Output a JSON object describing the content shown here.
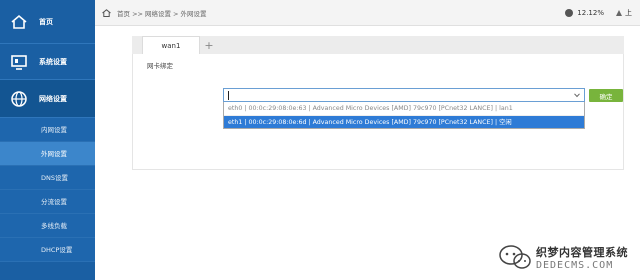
{
  "sidebar": {
    "top": {
      "label": "首页",
      "icon": "home-icon"
    },
    "items": [
      {
        "label": "系统设置",
        "icon": "monitor-icon"
      },
      {
        "label": "网络设置",
        "icon": "globe-icon"
      }
    ],
    "sub_items": [
      {
        "label": "内网设置",
        "selected": false
      },
      {
        "label": "外网设置",
        "selected": true
      },
      {
        "label": "DNS设置",
        "selected": false
      },
      {
        "label": "分流设置",
        "selected": false
      },
      {
        "label": "多线负载",
        "selected": false
      },
      {
        "label": "DHCP设置",
        "selected": false
      }
    ]
  },
  "topbar": {
    "breadcrumb": [
      "首页 >>",
      "网络设置 >",
      "外网设置"
    ],
    "cpu": "12.12%",
    "upload": "上"
  },
  "tabs": [
    {
      "label": "wan1",
      "active": true
    }
  ],
  "tab_add": "+",
  "form": {
    "label": "网卡绑定",
    "select_value": "",
    "options": [
      {
        "text": "eth0 | 00:0c:29:08:0e:63 | Advanced Micro Devices [AMD] 79c970 [PCnet32 LANCE] | lan1",
        "highlighted": false
      },
      {
        "text": "eth1 | 00:0c:29:08:0e:6d | Advanced Micro Devices [AMD] 79c970 [PCnet32 LANCE] | 空闲",
        "highlighted": true
      }
    ],
    "confirm_label": "确定"
  },
  "watermark": {
    "main": "织梦内容管理系统",
    "sub": "DEDECMS.COM"
  },
  "colors": {
    "sidebar": "#1a5fa3",
    "sub_selected": "#3c86cb",
    "option_highlight": "#2e7bd6",
    "confirm": "#78b43c"
  }
}
